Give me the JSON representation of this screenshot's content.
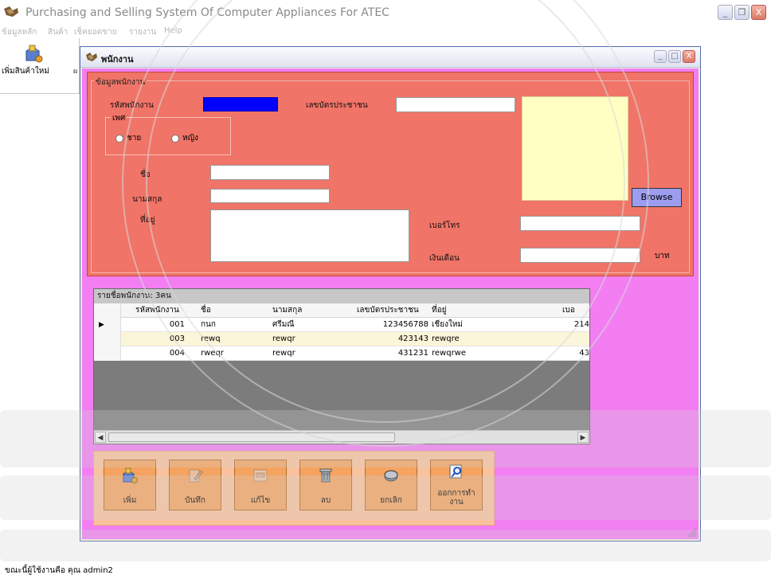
{
  "app": {
    "title": "Purchasing and Selling System  Of Computer Appliances For ATEC",
    "window_buttons": [
      "_",
      "❐",
      "X"
    ]
  },
  "menu": [
    "ข้อมูลหลัก",
    "สินค้า",
    "เช็คยอดขาย",
    "รายงาน",
    "Help"
  ],
  "toolbar": {
    "new_product": "เพิ่มสินค้าใหม่",
    "more": "ผ"
  },
  "child": {
    "title": "พนักงาน",
    "window_buttons": [
      "_",
      "□",
      "X"
    ]
  },
  "form": {
    "group_title": "ข้อมูลพนักงาน",
    "employee_id_label": "รหัสพนักงาน",
    "employee_id_value": "",
    "citizen_id_label": "เลขบัตรประชาชน",
    "citizen_id_value": "",
    "gender_title": "เพศ",
    "gender_male": "ชาย",
    "gender_female": "หญิง",
    "first_name_label": "ชื่อ",
    "first_name_value": "",
    "last_name_label": "นามสกุล",
    "last_name_value": "",
    "address_label": "ที่อยู่",
    "address_value": "",
    "phone_label": "เบอร์โทร",
    "phone_value": "",
    "salary_label": "เงินเดือน",
    "salary_value": "",
    "salary_unit": "บาท",
    "browse_label": "Browse"
  },
  "list": {
    "caption": "รายชื่อพนักงาน: 3คน",
    "headers": {
      "id": "รหัสพนักงาน",
      "first": "ชื่อ",
      "last": "นามสกุล",
      "citizen": "เลขบัตรประชาชน",
      "address": "ที่อยู่",
      "phone": "เบอ"
    },
    "rows": [
      {
        "id": "001",
        "first": "กนก",
        "last": "ศรีมณี",
        "citizen": "123456788",
        "address": "เชียงใหม่",
        "phone": "214"
      },
      {
        "id": "003",
        "first": "rewq",
        "last": "rewqr",
        "citizen": "423143",
        "address": "rewqre",
        "phone": ""
      },
      {
        "id": "004",
        "first": "rweqr",
        "last": "rewqr",
        "citizen": "431231",
        "address": "rewqrwe",
        "phone": "43"
      }
    ],
    "row_marker": "▶",
    "scroll_left": "◀",
    "scroll_right": "▶"
  },
  "actions": {
    "add": "เพิ่ม",
    "save": "บันทึก",
    "edit": "แก้ไข",
    "delete": "ลบ",
    "cancel": "ยกเลิก",
    "exit_line1": "ออกการทำ",
    "exit_line2": "งาน"
  },
  "status": {
    "prefix": "ขณะนี้ผู้ใช้งานคือ  คุณ",
    "user": "admin2"
  },
  "colors": {
    "child_body": "#f27ef2",
    "group_bg": "#f07467",
    "photo_bg": "#ffffc4",
    "button_bg": "#f4a460",
    "id_field": "#0000ff"
  }
}
